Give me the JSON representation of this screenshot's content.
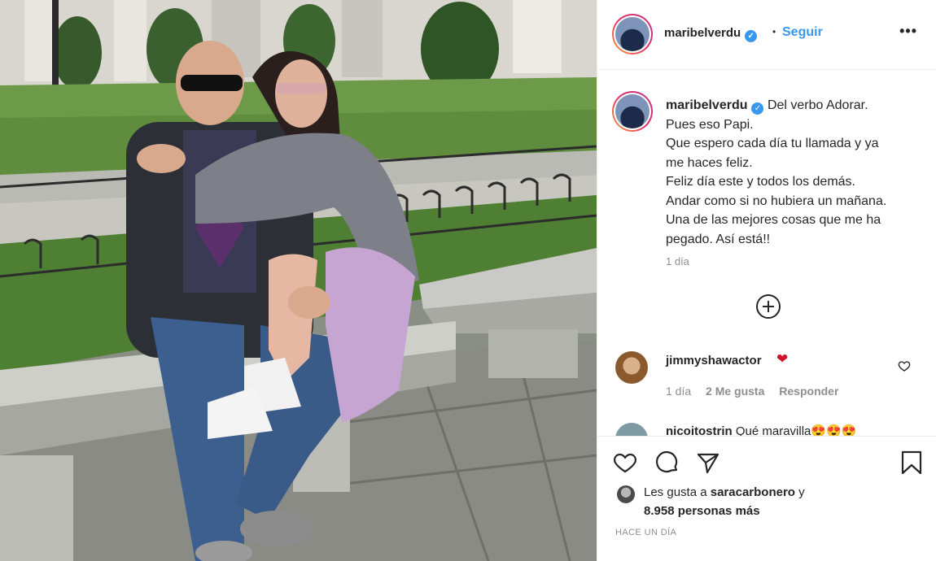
{
  "post": {
    "username": "maribelverdu",
    "dot": "•",
    "follow_label": "Seguir",
    "more_label": "•••"
  },
  "caption": {
    "username": "maribelverdu",
    "lines": [
      "Del verbo Adorar.",
      "Pues eso Papi.",
      "Que espero cada día tu llamada y ya",
      "me haces feliz.",
      "Feliz día este y todos los demás.",
      "Andar como si no hubiera un mañana.",
      "Una de las mejores cosas que me ha",
      "pegado. Así está!!"
    ],
    "age": "1 día"
  },
  "comments": [
    {
      "username": "jimmyshawactor",
      "text": "❤",
      "age": "1 día",
      "likes": "2 Me gusta",
      "reply_label": "Responder"
    },
    {
      "username": "nicoitostrin",
      "text": "Qué maravilla😍😍😍"
    }
  ],
  "likes": {
    "prefix": "Les gusta a",
    "first_user": "saracarbonero",
    "suffix": "y",
    "others": "8.958 personas más"
  },
  "timestamp": "HACE UN DÍA",
  "icons": [
    "verified-icon",
    "more-icon",
    "add-comment-icon",
    "heart-icon",
    "comment-icon",
    "share-icon",
    "bookmark-icon"
  ],
  "colors": {
    "link": "#3897f0",
    "text": "#262626",
    "muted": "#8e8e8e",
    "heart": "#d0122a"
  }
}
